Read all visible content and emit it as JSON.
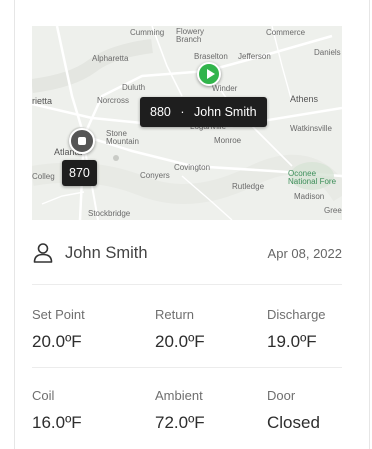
{
  "map": {
    "labels": {
      "cumming": "Cumming",
      "flowery_branch": "Flowery\nBranch",
      "commerce": "Commerce",
      "alpharetta": "Alpharetta",
      "braselton": "Braselton",
      "jefferson": "Jefferson",
      "daniels": "Daniels",
      "duluth": "Duluth",
      "winder": "Winder",
      "rietta": "rietta",
      "norcross": "Norcross",
      "athens": "Athens",
      "loganville": "Loganville",
      "atlanta": "Atlanta",
      "stone_mountain": "Stone\nMountain",
      "monroe": "Monroe",
      "watkinsville": "Watkinsville",
      "colleg": "Colleg",
      "conyers": "Conyers",
      "covington": "Covington",
      "rutledge": "Rutledge",
      "madison": "Madison",
      "oconee": "Oconee\nNational Fore",
      "stockbridge": "Stockbridge",
      "green": "Green"
    },
    "route_markers": [
      "140",
      "129",
      "33",
      "19",
      "53",
      "285",
      "316",
      "85",
      "78",
      "83",
      "441",
      "138",
      "20",
      "11",
      "29"
    ],
    "callout_main": {
      "id": "880",
      "separator": "·",
      "name": "John Smith"
    },
    "callout_small": {
      "id": "870"
    },
    "pin_active_color": "#31b44b",
    "pin_inactive_color": "#555555"
  },
  "user": {
    "name": "John Smith",
    "date": "Apr 08, 2022",
    "icon": "user-icon"
  },
  "stats": {
    "set_point": {
      "label": "Set Point",
      "value": "20.0ºF"
    },
    "return": {
      "label": "Return",
      "value": "20.0ºF"
    },
    "discharge": {
      "label": "Discharge",
      "value": "19.0ºF"
    },
    "coil": {
      "label": "Coil",
      "value": "16.0ºF"
    },
    "ambient": {
      "label": "Ambient",
      "value": "72.0ºF"
    },
    "door": {
      "label": "Door",
      "value": "Closed"
    }
  }
}
